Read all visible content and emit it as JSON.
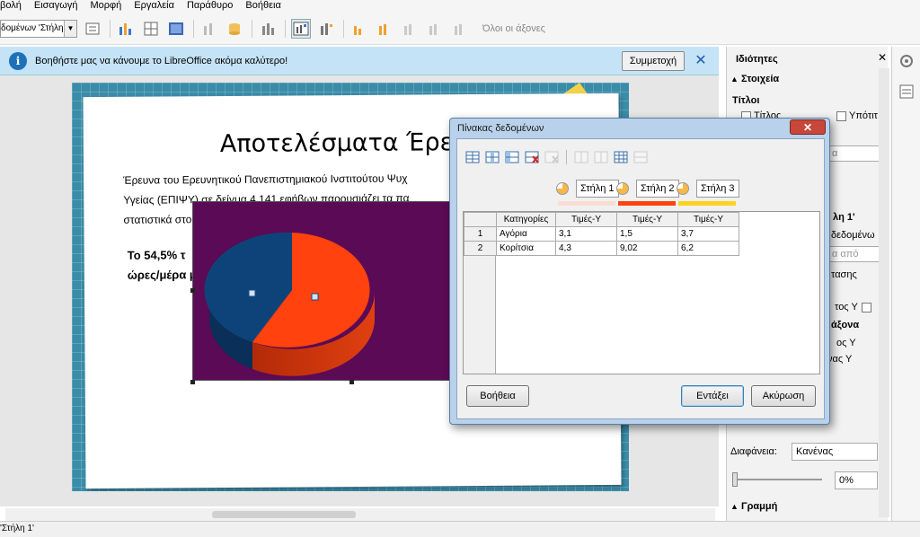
{
  "menu": [
    "βολή",
    "Εισαγωγή",
    "Μορφή",
    "Εργαλεία",
    "Παράθυρο",
    "Βοήθεια"
  ],
  "toolbar": {
    "select_value": "δομένων 'Στήλη 1'",
    "axes_label": "Όλοι οι άξονες"
  },
  "infobar": {
    "message": "Βοηθήστε μας να κάνουμε το LibreOffice ακόμα καλύτερο!",
    "join_label": "Συμμετοχή",
    "close_label": "✕"
  },
  "slide": {
    "title": "Αποτελέσματα Έρευν",
    "body_lines": [
      "Έρευνα του Ερευνητικού Πανεπιστημιακού Ινστιτούτου Ψυχ",
      "Υγείας (ΕΠΙΨΥ) σε δείγμα 4.141 εφήβων παρουσιάζει τα πα",
      "στατιστικά στο"
    ],
    "bold_lines": [
      "Το 54,5% τ",
      "ώρες/μέρα μ"
    ],
    "pie_colors": {
      "blue": "#0e437a",
      "orange": "#ff420e",
      "background": "#5b0a55"
    }
  },
  "sidebar": {
    "title": "Ιδιότητες",
    "close": "✕",
    "elements_section": "Στοιχεία",
    "titles_label": "Τίτλοι",
    "title_checkbox": "Τίτλος",
    "subtitle_checkbox": "Υπότιτ",
    "series_label": "λη 1'",
    "data_label": "δεδομένω",
    "from_label": "α από",
    "text_fragments": [
      "τασης",
      "τος Υ",
      "άξονα",
      "ος Υ",
      "νας Υ"
    ],
    "transparency_label": "Διαφάνεια:",
    "transparency_value": "Κανένας",
    "percent_value": "0%",
    "line_section": "Γραμμή",
    "collapse_glyph": "▲",
    "expand_glyph": "▶"
  },
  "dialog": {
    "title": "Πίνακας δεδομένων",
    "close": "✕",
    "series": [
      {
        "name": "Στήλη 1",
        "color": "#f9ddd3"
      },
      {
        "name": "Στήλη 2",
        "color": "#ff420e"
      },
      {
        "name": "Στήλη 3",
        "color": "#ffd320"
      }
    ],
    "columns": [
      "Κατηγορίες",
      "Τιμές-Υ",
      "Τιμές-Υ",
      "Τιμές-Υ"
    ],
    "rows": [
      {
        "num": "1",
        "cat": "Αγόρια",
        "v1": "3,1",
        "v2": "1,5",
        "v3": "3,7"
      },
      {
        "num": "2",
        "cat": "Κορίτσια",
        "v1": "4,3",
        "v2": "9,02",
        "v3": "6,2"
      }
    ],
    "help_label": "Βοήθεια",
    "ok_label": "Εντάξει",
    "cancel_label": "Ακύρωση"
  },
  "statusbar": {
    "text": "'Στήλη 1'"
  }
}
